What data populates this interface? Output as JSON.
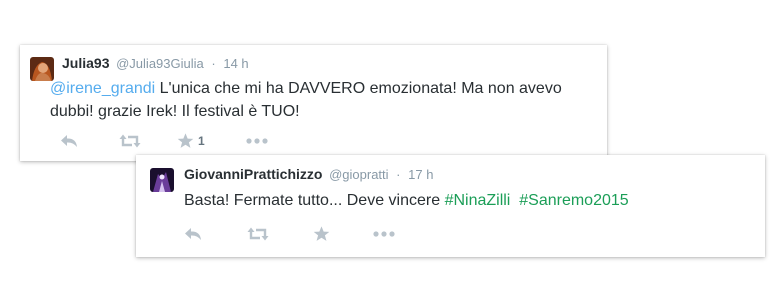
{
  "tweets": [
    {
      "fullname": "Julia93",
      "handle": "@Julia93Giulia",
      "separator": "·",
      "time": "14 h",
      "mention": "@irene_grandi",
      "text_line1": " L'unica che mi ha DAVVERO emozionata! Ma non avevo",
      "text_line2": "dubbi! grazie Irek! Il festival è TUO!",
      "favorite_count": "1",
      "avatar_icon": "user-photo-avatar"
    },
    {
      "fullname": "GiovanniPrattichizzo",
      "handle": "@giopratti",
      "separator": "·",
      "time": "17 h",
      "text": "Basta! Fermate tutto... Deve vincere ",
      "hashtag1": "#NinaZilli",
      "hashtag2": "#Sanremo2015",
      "avatar_icon": "user-photo-avatar"
    }
  ],
  "icons": {
    "reply": "reply-icon",
    "retweet": "retweet-icon",
    "favorite": "star-icon",
    "more": "more-icon"
  },
  "colors": {
    "text": "#292f33",
    "meta": "#8899a6",
    "mention": "#55acee",
    "hashtag": "#1b9e57",
    "action_icon": "#b9c3cb"
  }
}
